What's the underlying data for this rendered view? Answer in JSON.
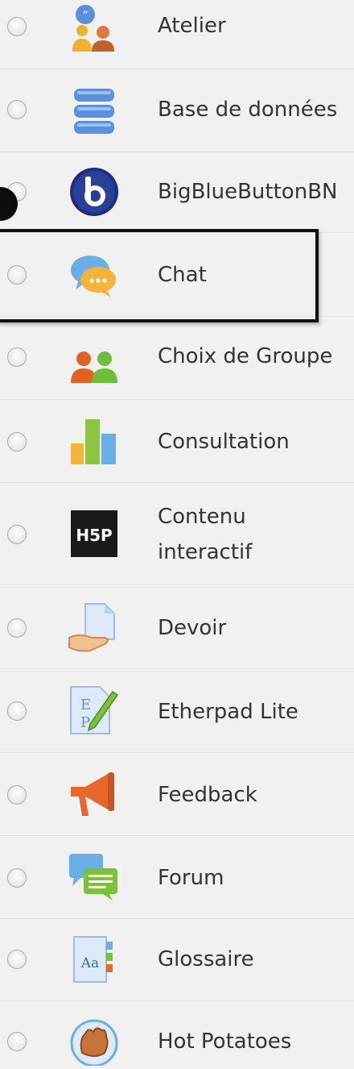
{
  "activities": [
    {
      "label": "Atelier",
      "icon": "workshop-icon"
    },
    {
      "label": "Base de données",
      "icon": "database-icon"
    },
    {
      "label": "BigBlueButtonBN",
      "icon": "bigbluebutton-icon"
    },
    {
      "label": "Chat",
      "icon": "chat-icon"
    },
    {
      "label": "Choix de Groupe",
      "icon": "group-choice-icon"
    },
    {
      "label": "Consultation",
      "icon": "consultation-chart-icon"
    },
    {
      "label": "Contenu interactif",
      "icon": "h5p-icon",
      "icon_text": "H5P"
    },
    {
      "label": "Devoir",
      "icon": "assignment-icon"
    },
    {
      "label": "Etherpad Lite",
      "icon": "etherpad-icon"
    },
    {
      "label": "Feedback",
      "icon": "megaphone-icon"
    },
    {
      "label": "Forum",
      "icon": "forum-icon"
    },
    {
      "label": "Glossaire",
      "icon": "glossary-icon",
      "icon_text": "Aa"
    },
    {
      "label": "Hot Potatoes",
      "icon": "hot-potatoes-icon"
    }
  ],
  "highlighted_item": "Chat"
}
